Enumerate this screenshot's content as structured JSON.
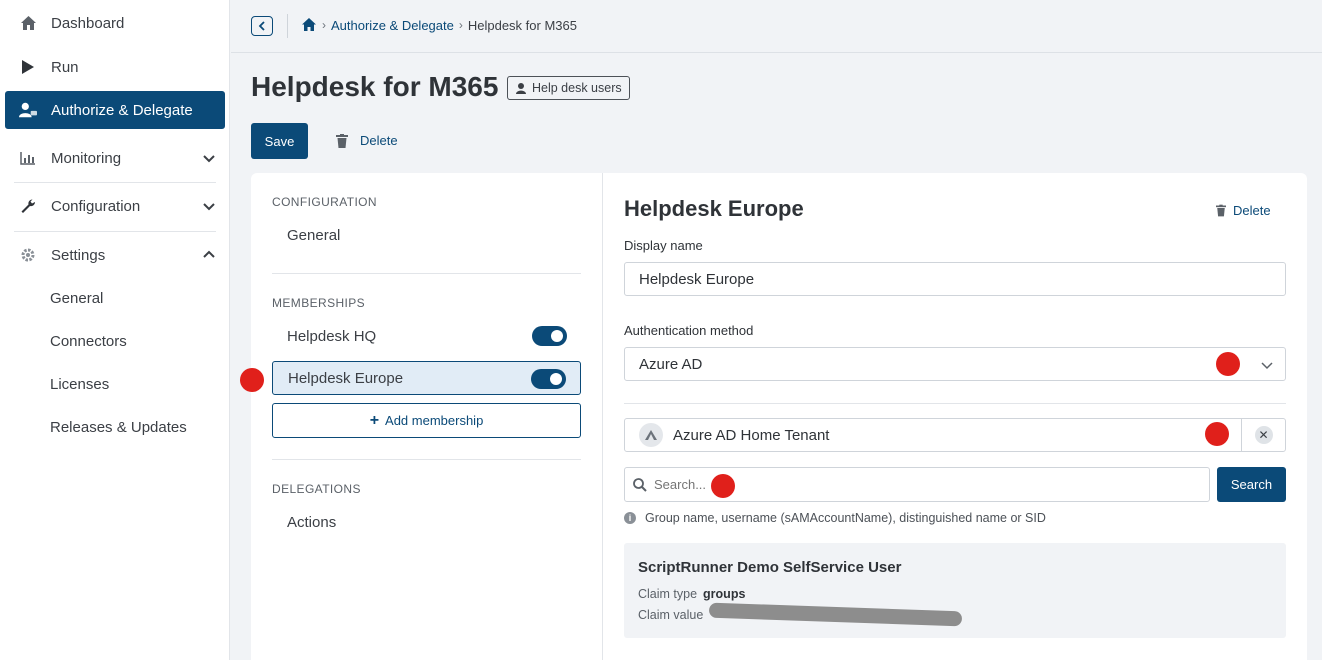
{
  "sidebar": {
    "items": [
      {
        "label": "Dashboard",
        "icon": "home-icon"
      },
      {
        "label": "Run",
        "icon": "play-icon"
      },
      {
        "label": "Authorize & Delegate",
        "icon": "user-key-icon"
      },
      {
        "label": "Monitoring",
        "icon": "chart-icon"
      },
      {
        "label": "Configuration",
        "icon": "wrench-icon"
      },
      {
        "label": "Settings",
        "icon": "gear-icon"
      }
    ],
    "settings_sub": [
      "General",
      "Connectors",
      "Licenses",
      "Releases & Updates"
    ]
  },
  "breadcrumb": {
    "items": [
      "Authorize & Delegate",
      "Helpdesk for M365"
    ]
  },
  "page": {
    "title": "Helpdesk for M365",
    "badge": "Help desk users",
    "save_label": "Save",
    "delete_label": "Delete"
  },
  "left": {
    "configuration_head": "CONFIGURATION",
    "configuration_items": [
      "General"
    ],
    "memberships_head": "MEMBERSHIPS",
    "memberships": [
      {
        "label": "Helpdesk HQ",
        "enabled": true
      },
      {
        "label": "Helpdesk Europe",
        "enabled": true
      }
    ],
    "add_membership": "Add membership",
    "delegations_head": "DELEGATIONS",
    "delegation_items": [
      "Actions"
    ]
  },
  "right": {
    "title": "Helpdesk Europe",
    "delete_label": "Delete",
    "display_name_label": "Display name",
    "display_name_value": "Helpdesk Europe",
    "auth_label": "Authentication method",
    "auth_value": "Azure AD",
    "tenant_value": "Azure AD Home Tenant",
    "search_placeholder": "Search...",
    "search_button": "Search",
    "hint": "Group name, username (sAMAccountName), distinguished name or SID",
    "result": {
      "title": "ScriptRunner Demo SelfService User",
      "claim_type_label": "Claim type",
      "claim_type_value": "groups",
      "claim_value_label": "Claim value"
    }
  },
  "colors": {
    "brand": "#0b4a78",
    "marker": "#e0201b"
  }
}
